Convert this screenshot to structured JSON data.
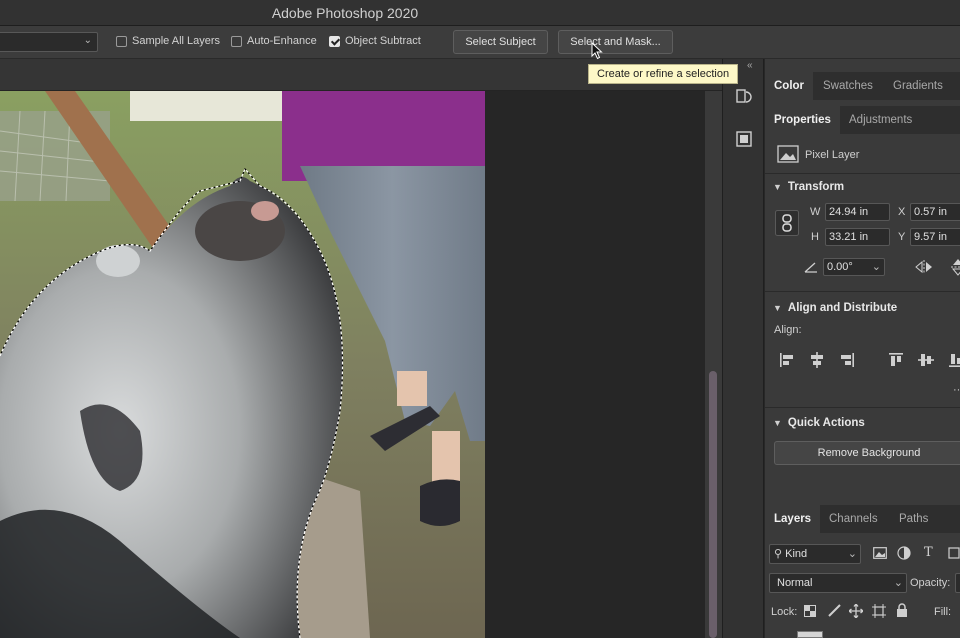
{
  "app": {
    "title": "Adobe Photoshop 2020"
  },
  "options_bar": {
    "mode_select": {
      "value": ""
    },
    "sample_all_layers": {
      "label": "Sample All Layers",
      "checked": false
    },
    "auto_enhance": {
      "label": "Auto-Enhance",
      "checked": false
    },
    "object_subtract": {
      "label": "Object Subtract",
      "checked": true
    },
    "select_subject": "Select Subject",
    "select_and_mask": "Select and Mask..."
  },
  "tooltip": {
    "text": "Create or refine a selection"
  },
  "panel_top": {
    "tabs": [
      "Color",
      "Swatches",
      "Gradients"
    ],
    "active": "Color"
  },
  "properties": {
    "tabs": [
      "Properties",
      "Adjustments"
    ],
    "active": "Properties",
    "layer_kind": "Pixel Layer",
    "transform": {
      "title": "Transform",
      "w_label": "W",
      "w": "24.94 in",
      "h_label": "H",
      "h": "33.21 in",
      "x_label": "X",
      "x": "0.57 in",
      "y_label": "Y",
      "y": "9.57 in",
      "angle": "0.00°"
    },
    "align": {
      "title": "Align and Distribute",
      "label": "Align:"
    },
    "quick_actions": {
      "title": "Quick Actions",
      "remove_background": "Remove Background"
    }
  },
  "layers": {
    "tabs": [
      "Layers",
      "Channels",
      "Paths"
    ],
    "active": "Layers",
    "filter": "Kind",
    "blend_mode": "Normal",
    "opacity_label": "Opacity:",
    "lock_label": "Lock:",
    "fill_label": "Fill:"
  },
  "colors": {
    "accent_panel": "#3a3a3a",
    "tooltip_bg": "#fdf8c7",
    "scroll_thumb": "#6a5f6a"
  }
}
